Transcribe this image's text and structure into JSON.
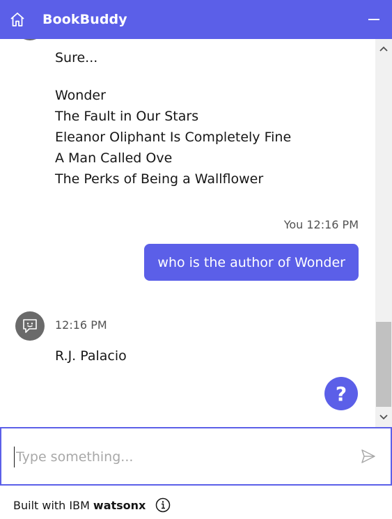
{
  "header": {
    "home_icon": "home-icon",
    "title": "BookBuddy",
    "minimize_icon": "minimize-icon"
  },
  "conversation": {
    "bot_intro": "Sure...",
    "bot_list": [
      "Wonder",
      "The Fault in Our Stars",
      "Eleanor Oliphant Is Completely Fine",
      "A Man Called Ove",
      "The Perks of Being a Wallflower"
    ],
    "user_meta": "You 12:16 PM",
    "user_message": "who is the author of Wonder",
    "bot_time": "12:16 PM",
    "bot_answer": "R.J. Palacio"
  },
  "help_button": {
    "label": "?"
  },
  "input": {
    "placeholder": "Type something...",
    "value": "",
    "send_icon": "send-icon"
  },
  "footer": {
    "prefix": "Built with IBM",
    "brand": "watsonx",
    "info_icon": "info-icon"
  },
  "colors": {
    "accent": "#5b5fe8",
    "avatar": "#6a6a6a",
    "scrollbar_track": "#f1f1f1",
    "scrollbar_thumb": "#c1c1c1"
  }
}
